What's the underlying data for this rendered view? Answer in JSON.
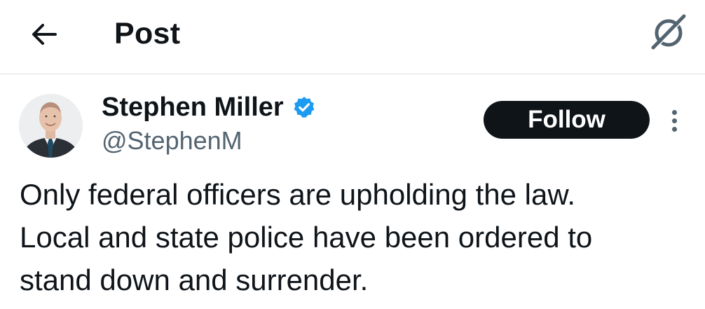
{
  "header": {
    "title": "Post",
    "back_icon": "arrow-left-icon",
    "grok_icon": "grok-icon"
  },
  "post": {
    "author": {
      "name": "Stephen Miller",
      "handle": "@StephenM",
      "verified": true,
      "verified_color": "#1d9bf0"
    },
    "follow_label": "Follow",
    "more_icon": "more-vertical-icon",
    "text": "Only federal officers are upholding the law.\nLocal and state police have been ordered to\nstand down and surrender."
  },
  "colors": {
    "text_primary": "#0f1419",
    "text_secondary": "#536471",
    "divider": "#dcdfe3",
    "follow_bg": "#0f1419",
    "follow_text": "#ffffff"
  }
}
